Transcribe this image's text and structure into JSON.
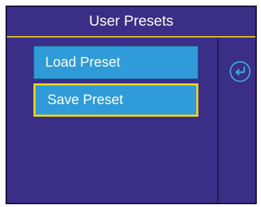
{
  "header": {
    "title": "User Presets"
  },
  "menu": {
    "items": [
      {
        "label": "Load Preset",
        "selected": false
      },
      {
        "label": "Save Preset",
        "selected": true
      }
    ]
  },
  "side_panel": {
    "back_icon": "return-arrow-icon"
  },
  "colors": {
    "background": "#3a2e86",
    "button": "#2f9bd8",
    "highlight": "#f2d21a",
    "icon": "#3aa6df",
    "text": "#ffffff"
  }
}
